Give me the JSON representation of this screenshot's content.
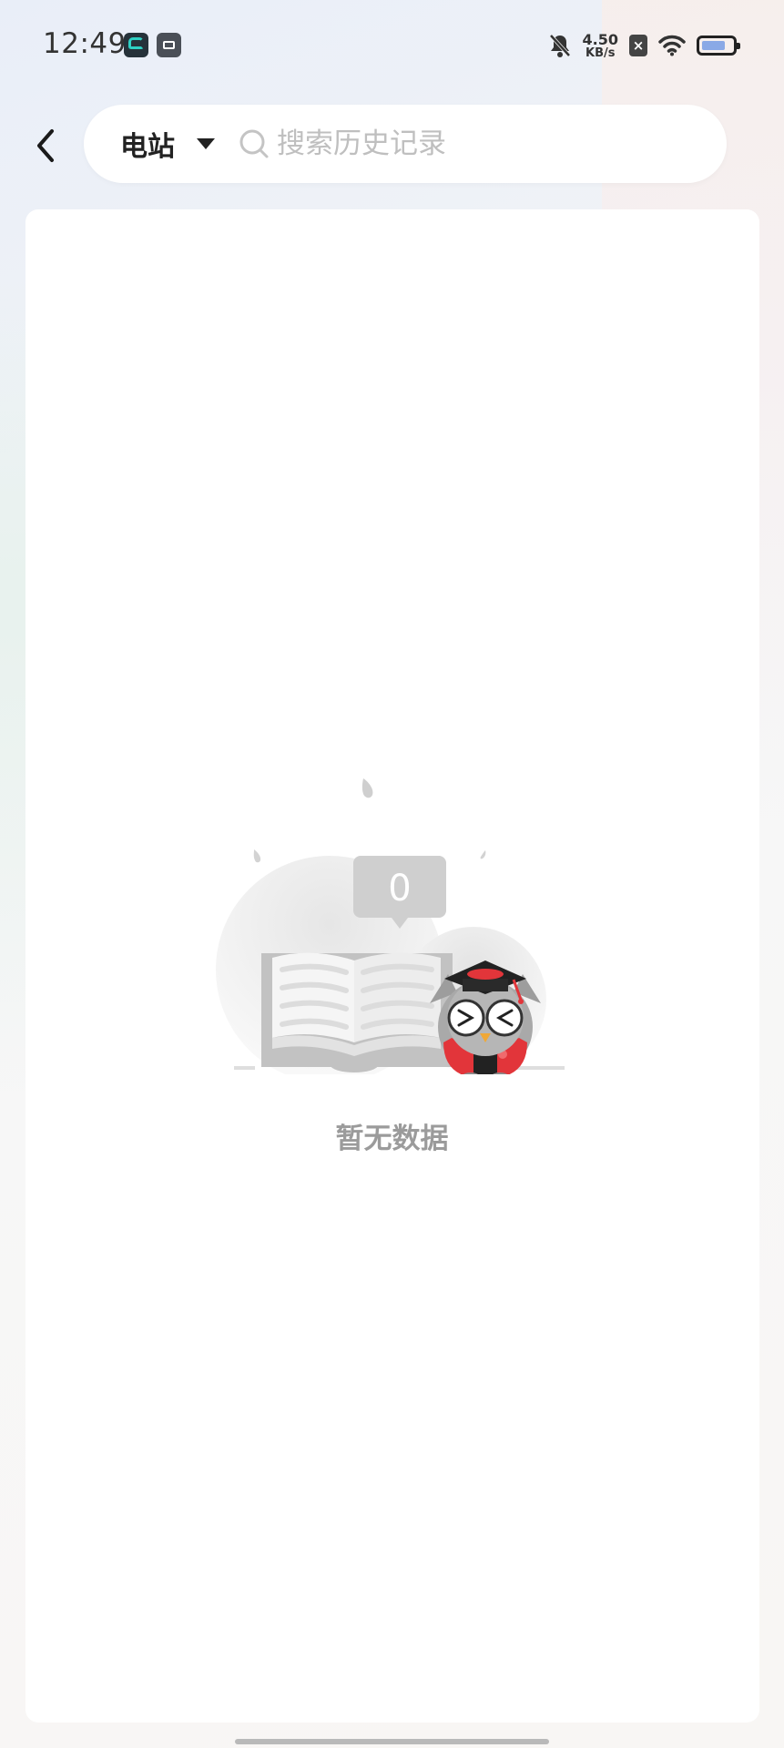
{
  "status_bar": {
    "time": "12:49",
    "net_speed_value": "4.50",
    "net_speed_unit": "KB/s",
    "icons": [
      "app-icon-teal",
      "app-icon-box",
      "bell-muted-icon",
      "sim-x-icon",
      "wifi-icon",
      "battery-icon"
    ],
    "battery_level": 0.65
  },
  "header": {
    "back_icon": "chevron-left-icon",
    "search": {
      "type_label": "电站",
      "type_dropdown_icon": "caret-down-icon",
      "search_icon": "search-icon",
      "placeholder": "搜索历史记录",
      "value": ""
    }
  },
  "empty_state": {
    "badge_count": "0",
    "message": "暂无数据",
    "illustration": "owl-graduate-book-illustration"
  },
  "colors": {
    "accent_red": "#e2353a",
    "placeholder_gray": "#bfbfbf",
    "empty_text_gray": "#9b9b9b"
  }
}
